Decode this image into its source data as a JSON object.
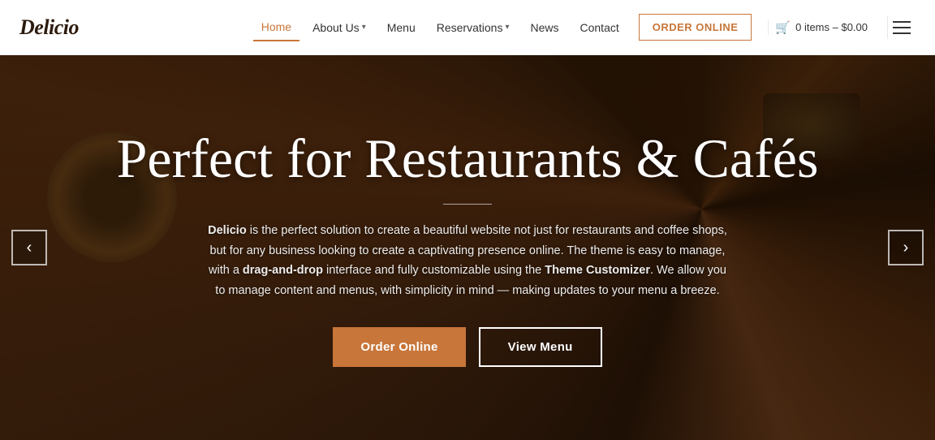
{
  "brand": {
    "logo": "Delicio"
  },
  "header": {
    "nav": [
      {
        "id": "home",
        "label": "Home",
        "active": true,
        "hasDropdown": false
      },
      {
        "id": "about",
        "label": "About Us",
        "active": false,
        "hasDropdown": true
      },
      {
        "id": "menu",
        "label": "Menu",
        "active": false,
        "hasDropdown": false
      },
      {
        "id": "reservations",
        "label": "Reservations",
        "active": false,
        "hasDropdown": true
      },
      {
        "id": "news",
        "label": "News",
        "active": false,
        "hasDropdown": false
      },
      {
        "id": "contact",
        "label": "Contact",
        "active": false,
        "hasDropdown": false
      }
    ],
    "order_button": "ORDER ONLINE",
    "cart": {
      "label": "0 items – $0.00",
      "icon": "cart"
    }
  },
  "hero": {
    "title": "Perfect for Restaurants & Cafés",
    "divider": true,
    "description_parts": [
      {
        "text": "Delicio",
        "bold": true
      },
      {
        "text": " is the perfect solution to create a beautiful website not just for restaurants and coffee shops, but for any business looking to create a captivating presence online. The theme is easy to manage, with a ",
        "bold": false
      },
      {
        "text": "drag-and-drop",
        "bold": true
      },
      {
        "text": " interface and fully customizable using the ",
        "bold": false
      },
      {
        "text": "Theme Customizer",
        "bold": true
      },
      {
        "text": ". We allow you to manage content and menus, with simplicity in mind — making updates to your menu a breeze.",
        "bold": false
      }
    ],
    "btn_order": "Order Online",
    "btn_menu": "View Menu",
    "arrow_left": "‹",
    "arrow_right": "›"
  },
  "colors": {
    "accent": "#c8763a",
    "dark": "#2c1a0e",
    "white": "#ffffff"
  }
}
